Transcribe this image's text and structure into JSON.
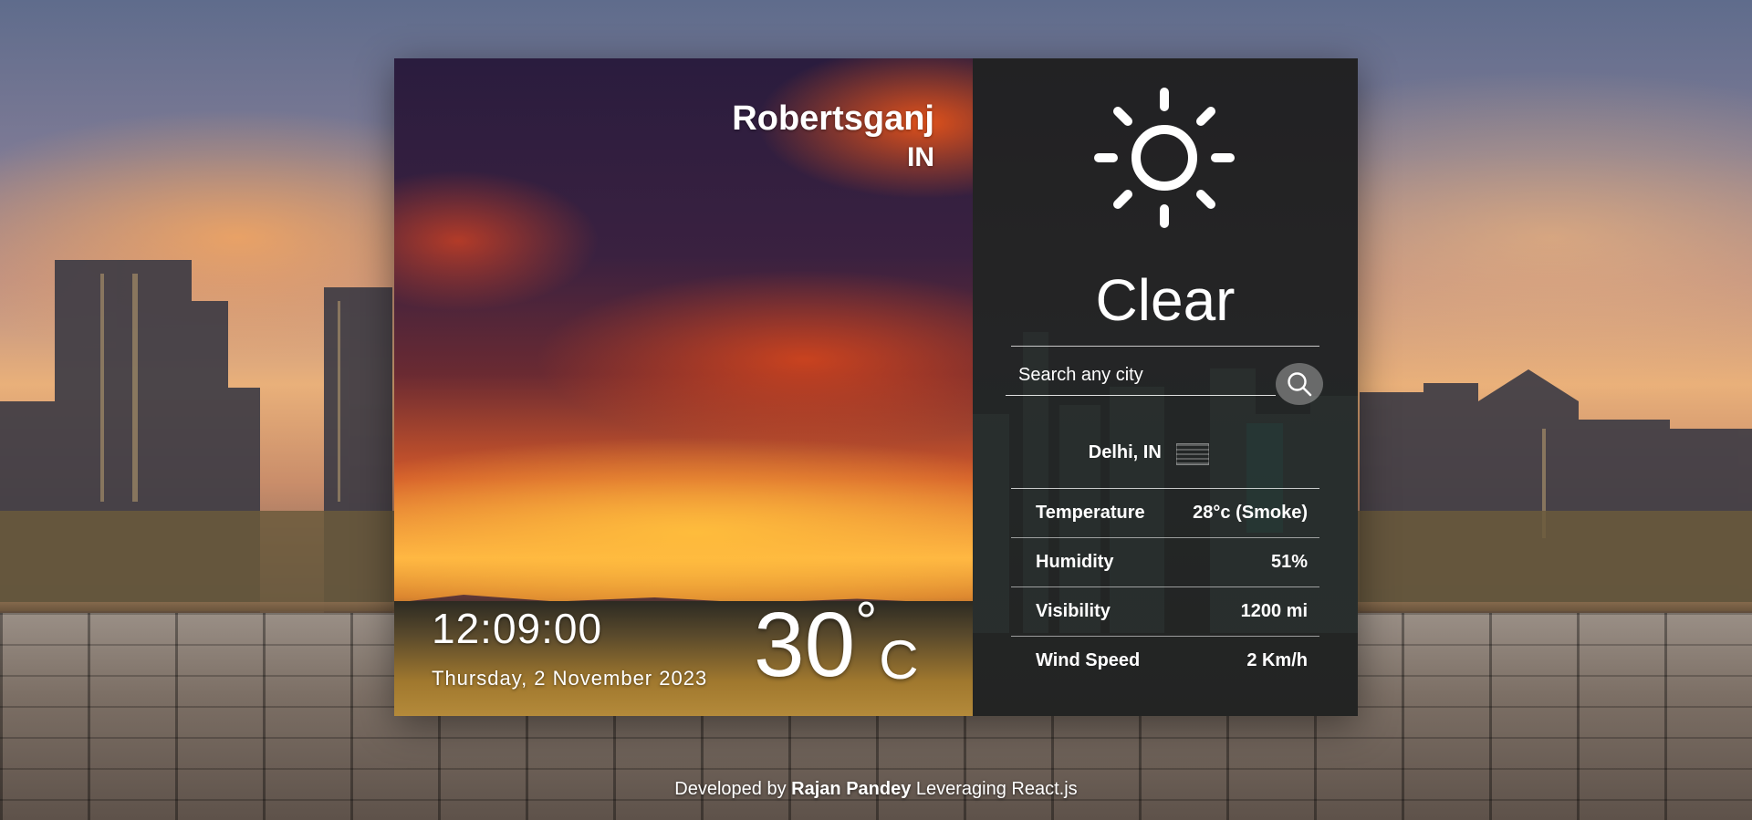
{
  "location": {
    "city": "Robertsganj",
    "country": "IN"
  },
  "clock": {
    "time": "12:09:00",
    "date": "Thursday, 2 November 2023"
  },
  "temperature": {
    "value": "30",
    "degree": "°",
    "unit": "C"
  },
  "weather": {
    "condition": "Clear",
    "icon": "sun-icon"
  },
  "search": {
    "placeholder": "Search any city",
    "icon": "search-icon"
  },
  "result": {
    "city": "Delhi, IN"
  },
  "stats": [
    {
      "label": "Temperature",
      "value": "28°c (Smoke)"
    },
    {
      "label": "Humidity",
      "value": "51%"
    },
    {
      "label": "Visibility",
      "value": "1200 mi"
    },
    {
      "label": "Wind Speed",
      "value": "2 Km/h"
    }
  ],
  "footer": {
    "prefix": "Developed by",
    "author": "Rajan Pandey",
    "suffix": "Leveraging React.js"
  }
}
